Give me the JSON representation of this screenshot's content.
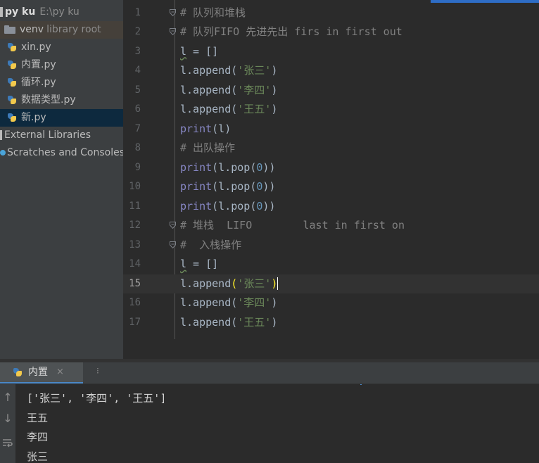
{
  "project_tree": {
    "root": {
      "name": "py ku",
      "path": "E:\\py ku"
    },
    "items": [
      {
        "type": "folder",
        "label": "venv",
        "tag": "library root"
      },
      {
        "type": "python-file",
        "label": "xin.py"
      },
      {
        "type": "python-file",
        "label": "内置.py"
      },
      {
        "type": "python-file",
        "label": "循环.py"
      },
      {
        "type": "python-file",
        "label": "数据类型.py"
      },
      {
        "type": "python-file",
        "label": "新.py",
        "selected": true
      }
    ],
    "external_libraries": "External Libraries",
    "scratches": "Scratches and Consoles"
  },
  "editor": {
    "current_line": 15,
    "lines": [
      {
        "num": "1",
        "segments": [
          {
            "t": "# 队列和堆栈",
            "c": "comment"
          }
        ]
      },
      {
        "num": "2",
        "segments": [
          {
            "t": "# 队列FIFO 先进先出 firs in first out",
            "c": "comment"
          }
        ]
      },
      {
        "num": "3",
        "segments": [
          {
            "t": "l",
            "c": "var"
          },
          {
            "t": " = []",
            "c": "plain"
          }
        ]
      },
      {
        "num": "4",
        "segments": [
          {
            "t": "l.append(",
            "c": "plain"
          },
          {
            "t": "'张三'",
            "c": "string"
          },
          {
            "t": ")",
            "c": "plain"
          }
        ]
      },
      {
        "num": "5",
        "segments": [
          {
            "t": "l.append(",
            "c": "plain"
          },
          {
            "t": "'李四'",
            "c": "string"
          },
          {
            "t": ")",
            "c": "plain"
          }
        ]
      },
      {
        "num": "6",
        "segments": [
          {
            "t": "l.append(",
            "c": "plain"
          },
          {
            "t": "'王五'",
            "c": "string"
          },
          {
            "t": ")",
            "c": "plain"
          }
        ]
      },
      {
        "num": "7",
        "segments": [
          {
            "t": "print",
            "c": "builtin"
          },
          {
            "t": "(l)",
            "c": "plain"
          }
        ]
      },
      {
        "num": "8",
        "segments": [
          {
            "t": "# 出队操作",
            "c": "comment"
          }
        ]
      },
      {
        "num": "9",
        "segments": [
          {
            "t": "print",
            "c": "builtin"
          },
          {
            "t": "(l.pop(",
            "c": "plain"
          },
          {
            "t": "0",
            "c": "number"
          },
          {
            "t": "))",
            "c": "plain"
          }
        ]
      },
      {
        "num": "10",
        "segments": [
          {
            "t": "print",
            "c": "builtin"
          },
          {
            "t": "(l.pop(",
            "c": "plain"
          },
          {
            "t": "0",
            "c": "number"
          },
          {
            "t": "))",
            "c": "plain"
          }
        ]
      },
      {
        "num": "11",
        "segments": [
          {
            "t": "print",
            "c": "builtin"
          },
          {
            "t": "(l.pop(",
            "c": "plain"
          },
          {
            "t": "0",
            "c": "number"
          },
          {
            "t": "))",
            "c": "plain"
          }
        ]
      },
      {
        "num": "12",
        "segments": [
          {
            "t": "# 堆栈  LIFO        last in first on",
            "c": "comment"
          }
        ]
      },
      {
        "num": "13",
        "segments": [
          {
            "t": "#  入栈操作",
            "c": "comment"
          }
        ]
      },
      {
        "num": "14",
        "segments": [
          {
            "t": "l",
            "c": "var"
          },
          {
            "t": " = []",
            "c": "plain"
          }
        ]
      },
      {
        "num": "15",
        "segments": [
          {
            "t": "l.append",
            "c": "plain"
          },
          {
            "t": "(",
            "c": "brace"
          },
          {
            "t": "'张三'",
            "c": "string"
          },
          {
            "t": ")",
            "c": "brace"
          }
        ]
      },
      {
        "num": "16",
        "segments": [
          {
            "t": "l.append(",
            "c": "plain"
          },
          {
            "t": "'李四'",
            "c": "string"
          },
          {
            "t": ")",
            "c": "plain"
          }
        ]
      },
      {
        "num": "17",
        "segments": [
          {
            "t": "l.append(",
            "c": "plain"
          },
          {
            "t": "'王五'",
            "c": "string"
          },
          {
            "t": ")",
            "c": "plain"
          }
        ]
      }
    ],
    "folds": [
      "1",
      "2",
      "12",
      "13"
    ]
  },
  "run_panel": {
    "tab_label": "内置",
    "tab_close": "×",
    "more": "⁝",
    "output": [
      "['张三', '李四', '王五']",
      "王五",
      "李四",
      "张三"
    ]
  },
  "toolbar_icons": [
    "arrow-up-icon",
    "arrow-down-icon",
    "soft-wrap-icon"
  ],
  "colors": {
    "comment": "#808080",
    "string": "#6a8759",
    "builtin": "#8888c6",
    "number": "#6897bb",
    "selection": "#0d293e",
    "accent": "#4a88c7"
  }
}
